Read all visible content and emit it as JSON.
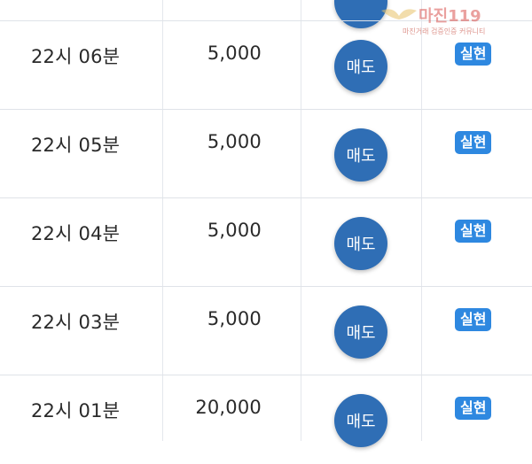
{
  "rows": [
    {
      "time": "22시 06분",
      "amount": "5,000",
      "action": "매도",
      "result": "실현"
    },
    {
      "time": "22시 05분",
      "amount": "5,000",
      "action": "매도",
      "result": "실현"
    },
    {
      "time": "22시 04분",
      "amount": "5,000",
      "action": "매도",
      "result": "실현"
    },
    {
      "time": "22시 03분",
      "amount": "5,000",
      "action": "매도",
      "result": "실현"
    },
    {
      "time": "22시 01분",
      "amount": "20,000",
      "action": "매도",
      "result": "실현"
    }
  ],
  "watermark": {
    "title": "마진119",
    "subtitle": "마진거래 검증인증 커뮤니티"
  },
  "colors": {
    "sell_button": "#2f6eb5",
    "result_badge": "#2e88e0",
    "divider": "#dfe3e8"
  }
}
